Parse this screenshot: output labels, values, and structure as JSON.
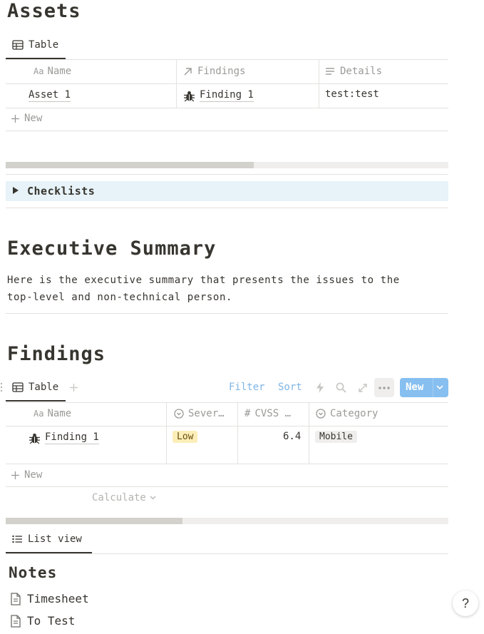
{
  "assets": {
    "title": "Assets",
    "view_tab": "Table",
    "columns": [
      "Name",
      "Findings",
      "Details"
    ],
    "rows": [
      {
        "name": "Asset 1",
        "finding": "Finding 1",
        "details": "test:test"
      }
    ],
    "new_label": "New",
    "scroll_fraction": 0.56
  },
  "checklists": {
    "label": "Checklists"
  },
  "executive_summary": {
    "title": "Executive Summary",
    "text_line1": "Here is the executive summary that presents the issues to the",
    "text_line2": "top-level and non-technical person."
  },
  "findings": {
    "title": "Findings",
    "view_tab": "Table",
    "toolbar": {
      "filter": "Filter",
      "sort": "Sort",
      "new": "New"
    },
    "columns": [
      "Name",
      "Sever…",
      "CVSS …",
      "Category"
    ],
    "rows": [
      {
        "name": "Finding 1",
        "severity": "Low",
        "cvss": "6.4",
        "category": "Mobile"
      }
    ],
    "new_label": "New",
    "calculate_label": "Calculate",
    "scroll_fraction": 0.4
  },
  "notes_view": {
    "tab": "List view",
    "title": "Notes",
    "items": [
      "Timesheet",
      "To Test"
    ]
  },
  "help_label": "?",
  "colors": {
    "accent": "#2383e2",
    "new_button": "#86bff0",
    "checklist_bg": "#e7f3f8",
    "tag_low": "#fbeeb8",
    "tag_mobile": "#efeeec"
  }
}
